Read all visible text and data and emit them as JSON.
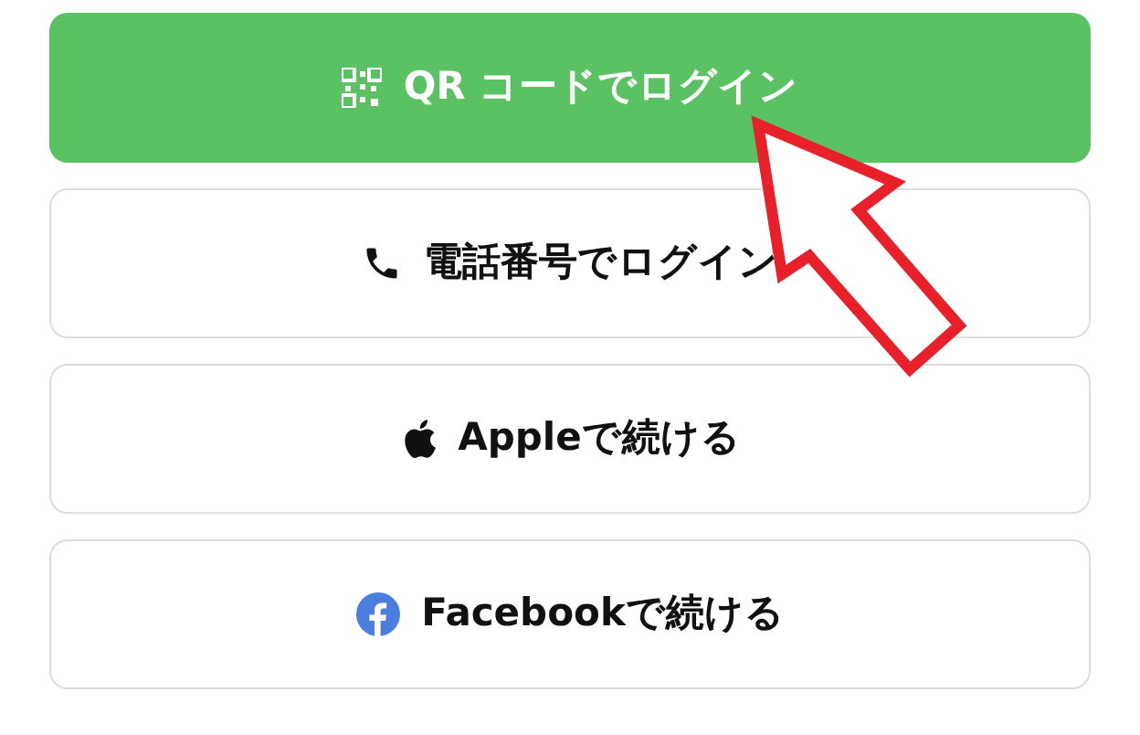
{
  "buttons": [
    {
      "kind": "qr",
      "label": "QR コードでログイン",
      "primary": true
    },
    {
      "kind": "phone",
      "label": "電話番号でログイン",
      "primary": false
    },
    {
      "kind": "apple",
      "label": "Appleで続ける",
      "primary": false
    },
    {
      "kind": "facebook",
      "label": "Facebookで続ける",
      "primary": false
    }
  ],
  "annotation": {
    "kind": "arrow"
  }
}
